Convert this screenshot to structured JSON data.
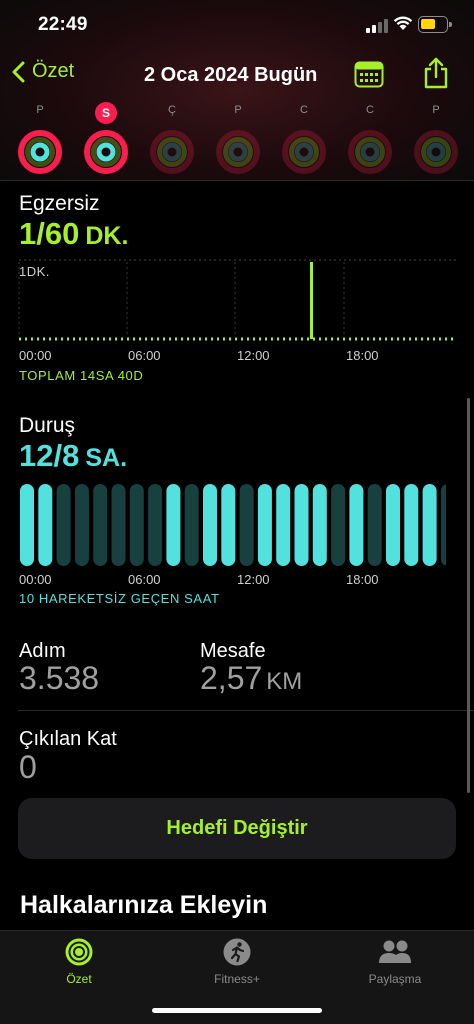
{
  "status_bar": {
    "time": "22:49"
  },
  "nav": {
    "back_label": "Özet",
    "title": "2 Oca 2024 Bugün"
  },
  "week": [
    {
      "letter": "P",
      "today": false,
      "active": true
    },
    {
      "letter": "S",
      "today": true,
      "active": true
    },
    {
      "letter": "Ç",
      "today": false,
      "active": false
    },
    {
      "letter": "P",
      "today": false,
      "active": false
    },
    {
      "letter": "C",
      "today": false,
      "active": false
    },
    {
      "letter": "C",
      "today": false,
      "active": false
    },
    {
      "letter": "P",
      "today": false,
      "active": false
    }
  ],
  "exercise": {
    "title": "Egzersiz",
    "value": "1/60",
    "unit": "DK.",
    "chart_label": "1DK.",
    "ticks": [
      "00:00",
      "06:00",
      "12:00",
      "18:00"
    ],
    "total": "TOPLAM 14SA 40D"
  },
  "stand": {
    "title": "Duruş",
    "value": "12/8",
    "unit": "SA.",
    "ticks": [
      "00:00",
      "06:00",
      "12:00",
      "18:00"
    ],
    "summary": "10 HAREKETSİZ GEÇEN SAAT",
    "hours_stood": [
      1,
      1,
      0,
      0,
      0,
      0,
      0,
      0,
      1,
      0,
      1,
      1,
      0,
      1,
      1,
      1,
      1,
      0,
      1,
      0,
      1,
      1,
      1,
      0,
      0
    ]
  },
  "steps": {
    "label": "Adım",
    "value": "3.538"
  },
  "distance": {
    "label": "Mesafe",
    "value": "2,57",
    "unit": "KM"
  },
  "flights": {
    "label": "Çıkılan Kat",
    "value": "0"
  },
  "change_goal_label": "Hedefi Değiştir",
  "add_rings_title": "Halkalarınıza Ekleyin",
  "tabbar": {
    "tabs": [
      {
        "label": "Özet",
        "active": true,
        "icon": "rings-icon"
      },
      {
        "label": "Fitness+",
        "active": false,
        "icon": "runner-icon"
      },
      {
        "label": "Paylaşma",
        "active": false,
        "icon": "people-icon"
      }
    ]
  },
  "colors": {
    "accent_green": "#a6f02a",
    "stand_cyan": "#52e1dc",
    "move_red": "#fa1e4e"
  }
}
